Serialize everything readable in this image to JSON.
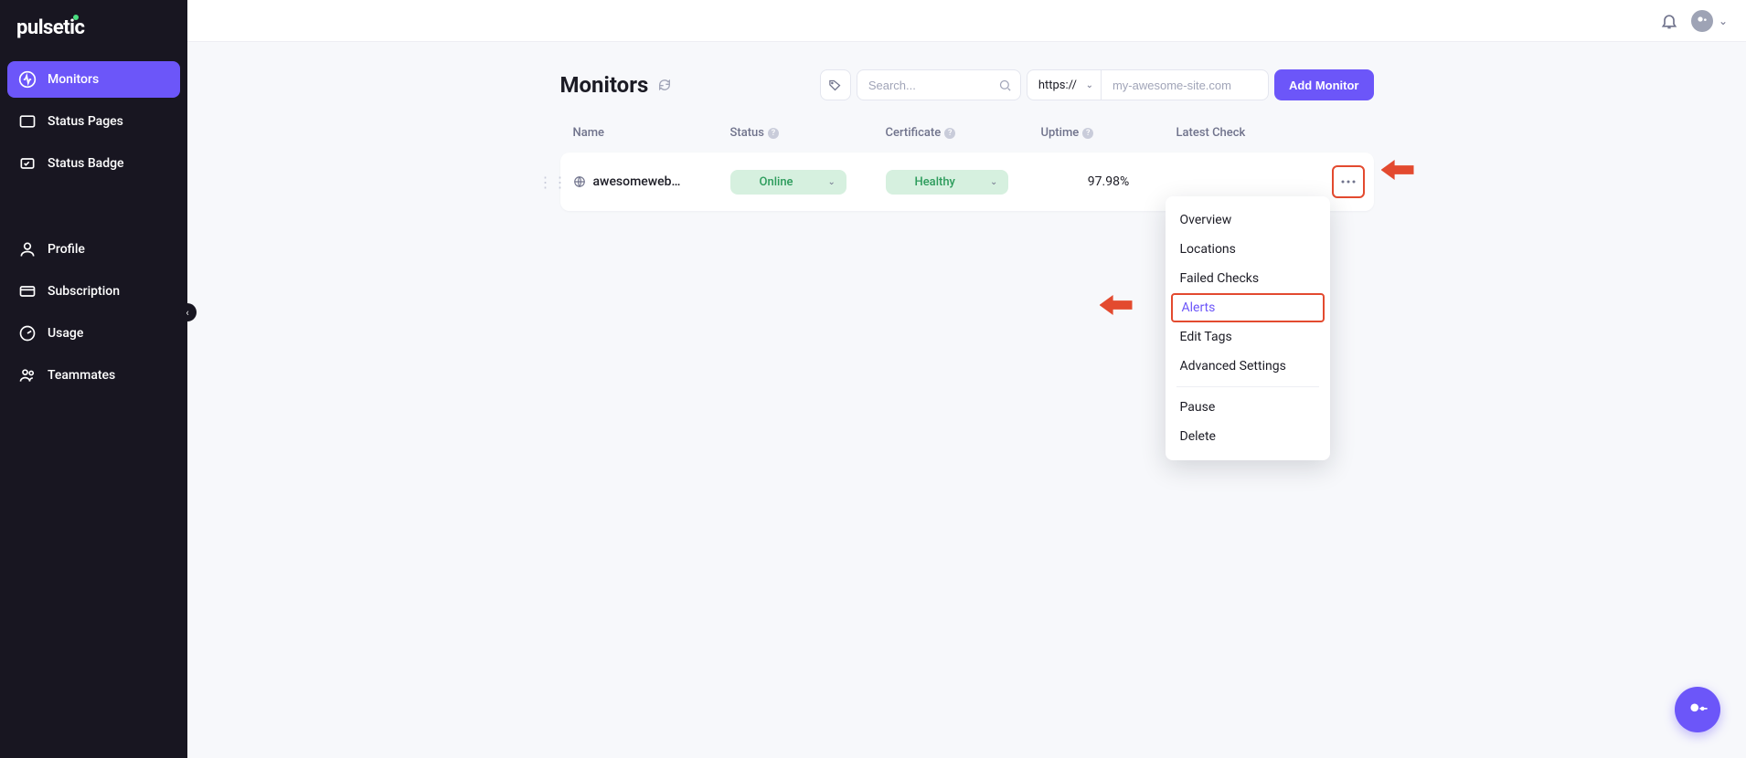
{
  "brand": "pulsetic",
  "sidebar": {
    "items": [
      {
        "label": "Monitors",
        "icon": "pulse-icon",
        "active": true
      },
      {
        "label": "Status Pages",
        "icon": "window-icon"
      },
      {
        "label": "Status Badge",
        "icon": "badge-icon"
      }
    ],
    "items2": [
      {
        "label": "Profile",
        "icon": "user-icon"
      },
      {
        "label": "Subscription",
        "icon": "card-icon"
      },
      {
        "label": "Usage",
        "icon": "gauge-icon"
      },
      {
        "label": "Teammates",
        "icon": "team-icon"
      }
    ]
  },
  "page": {
    "title": "Monitors",
    "search_placeholder": "Search...",
    "protocol": "https://",
    "site_placeholder": "my-awesome-site.com",
    "add_button": "Add Monitor"
  },
  "table": {
    "headers": {
      "name": "Name",
      "status": "Status",
      "certificate": "Certificate",
      "uptime": "Uptime",
      "latest": "Latest Check"
    },
    "row": {
      "name": "awesomewebs...",
      "status": "Online",
      "certificate": "Healthy",
      "uptime": "97.98%"
    }
  },
  "dropdown": {
    "overview": "Overview",
    "locations": "Locations",
    "failed_checks": "Failed Checks",
    "alerts": "Alerts",
    "edit_tags": "Edit Tags",
    "advanced": "Advanced Settings",
    "pause": "Pause",
    "delete": "Delete"
  }
}
